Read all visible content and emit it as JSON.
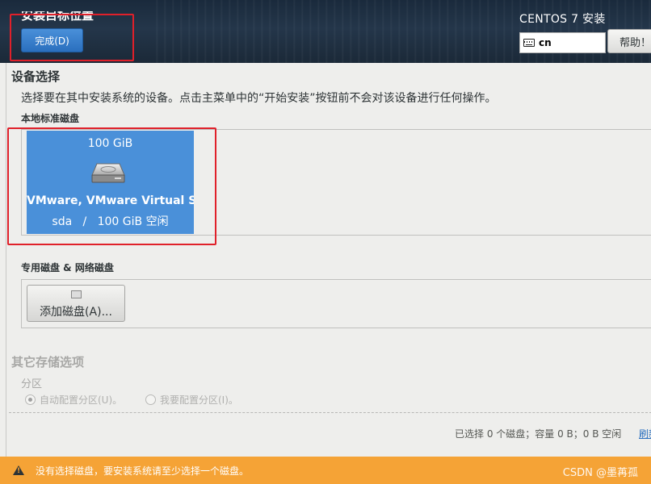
{
  "header": {
    "page_title": "安装目标位置",
    "done_label": "完成(D)",
    "product_title": "CENTOS 7 安装",
    "keyboard_layout": "cn",
    "help_label": "帮助！"
  },
  "device_selection": {
    "title": "设备选择",
    "description": "选择要在其中安装系统的设备。点击主菜单中的“开始安装”按钮前不会对该设备进行任何操作。",
    "local_disks_title": "本地标准磁盘",
    "disks": [
      {
        "size": "100 GiB",
        "name": "VMware, VMware Virtual S",
        "info": "sda   /   100 GiB 空闲",
        "icon": "hard-disk-icon",
        "selected": true
      }
    ],
    "specialized_title": "专用磁盘 & 网络磁盘",
    "add_disk_label": "添加磁盘(A)..."
  },
  "other_storage": {
    "title": "其它存储选项",
    "partition_label": "分区",
    "auto_partition_label": "自动配置分区(U)。",
    "manual_partition_label": "我要配置分区(I)。",
    "selected_option": "auto"
  },
  "summary": {
    "text": "已选择 0 个磁盘；容量 0 B；0 B 空闲",
    "refresh_label": "刷新"
  },
  "warning": {
    "text": "没有选择磁盘，要安装系统请至少选择一个磁盘。",
    "icon": "warning-icon"
  },
  "watermark": "CSDN @墨苒孤",
  "colors": {
    "accent": "#4a90d9",
    "warning": "#f5a336",
    "highlight_box": "#e0202a"
  }
}
